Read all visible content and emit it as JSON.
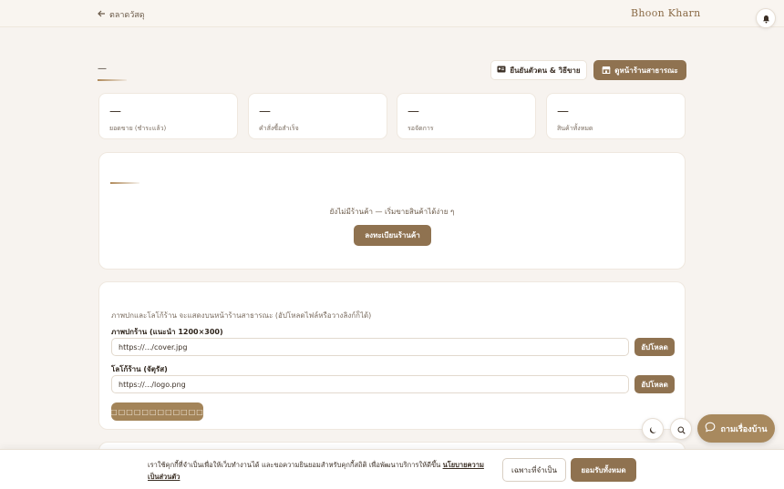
{
  "header": {
    "back_label": "ตลาดวัสดุ",
    "brand": "Bhoon Kharn"
  },
  "page": {
    "heading": "—"
  },
  "actions": {
    "verify_label": "ยืนยันตัวตน & วิธีขาย",
    "view_shop_label": "ดูหน้าร้านสาธารณะ"
  },
  "stats": [
    {
      "value": "—",
      "label": "ยอดขาย (ชำระแล้ว)"
    },
    {
      "value": "—",
      "label": "คำสั่งซื้อสำเร็จ"
    },
    {
      "value": "—",
      "label": "รอจัดการ"
    },
    {
      "value": "—",
      "label": "สินค้าทั้งหมด"
    }
  ],
  "empty_state": {
    "message": "ยังไม่มีร้านค้า — เริ่มขายสินค้าได้ง่าย ๆ",
    "register_label": "ลงทะเบียนร้านค้า"
  },
  "media": {
    "hint": "ภาพปกและโลโก้ร้าน จะแสดงบนหน้าร้านสาธารณะ (อัปโหลดไฟล์หรือวางลิงก์ก็ได้)",
    "cover_label": "ภาพปกร้าน (แนะนำ 1200×300)",
    "cover_value": "https://.../cover.jpg",
    "logo_label": "โลโก้ร้าน (จัตุรัส)",
    "logo_value": "https://.../logo.png",
    "upload_label": "อัปโหลด",
    "save_label": "□□□□□□□□□□□□"
  },
  "floating": {
    "ask_label": "ถามเรื่องบ้าน"
  },
  "cookie": {
    "text": "เราใช้คุกกี้ที่จำเป็นเพื่อให้เว็บทำงานได้ และขอความยินยอมสำหรับคุกกี้สถิติ เพื่อพัฒนาบริการให้ดีขึ้น",
    "policy_link": "นโยบายความเป็นส่วนตัว",
    "essential_label": "เฉพาะที่จำเป็น",
    "accept_label": "ยอมรับทั้งหมด"
  }
}
